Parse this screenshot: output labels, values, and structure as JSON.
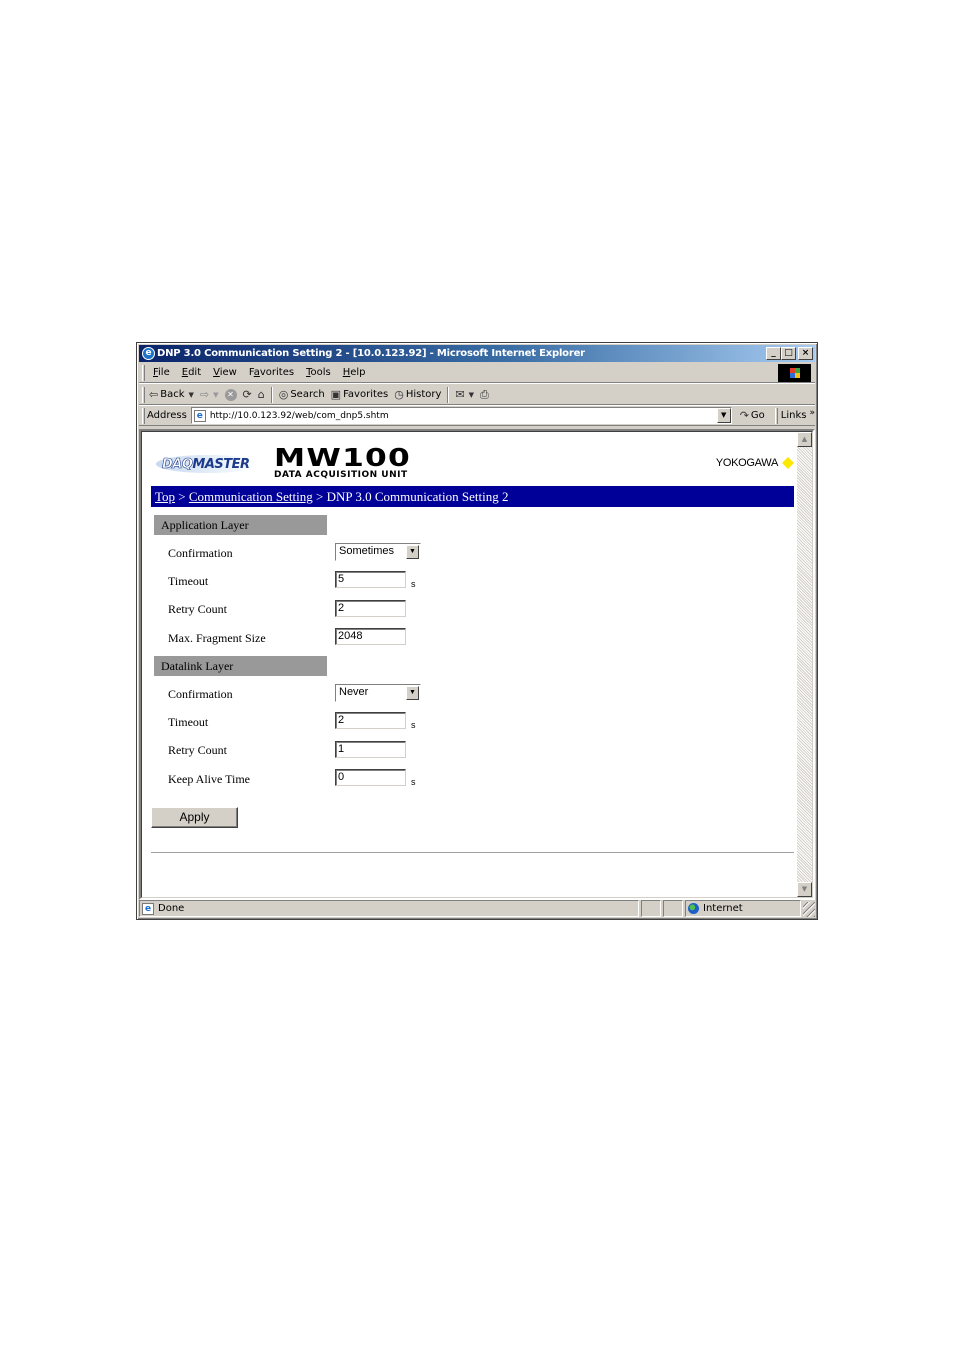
{
  "window": {
    "title": "DNP 3.0 Communication Setting 2 - [10.0.123.92] - Microsoft Internet Explorer",
    "controls": {
      "minimize": "_",
      "maximize": "□",
      "close": "×"
    }
  },
  "menubar": {
    "items": [
      {
        "label": "File",
        "accel": "F",
        "rest": "ile"
      },
      {
        "label": "Edit",
        "accel": "E",
        "rest": "dit"
      },
      {
        "label": "View",
        "accel": "V",
        "rest": "iew"
      },
      {
        "label": "Favorites",
        "pre": "F",
        "accel": "a",
        "rest": "vorites"
      },
      {
        "label": "Tools",
        "accel": "T",
        "rest": "ools"
      },
      {
        "label": "Help",
        "accel": "H",
        "rest": "elp"
      }
    ]
  },
  "toolbar": {
    "back": "Back",
    "search": "Search",
    "favorites": "Favorites",
    "history": "History",
    "icons": {
      "back": "back-arrow-icon",
      "forward": "forward-arrow-icon",
      "stop": "stop-icon",
      "refresh": "refresh-icon",
      "home": "home-icon",
      "search": "search-icon",
      "favorites": "favorites-icon",
      "history": "history-icon",
      "mail": "mail-icon",
      "print": "print-icon"
    }
  },
  "addressbar": {
    "label": "Address",
    "url": "http://10.0.123.92/web/com_dnp5.shtm",
    "go": "Go",
    "links": "Links"
  },
  "page": {
    "logo_brand": "DAQMASTER",
    "logo_brand_prefix": "DAQ",
    "logo_brand_suffix": "MASTER",
    "logo_model": "MW100",
    "logo_subtitle": "DATA ACQUISITION UNIT",
    "vendor": "YOKOGAWA",
    "breadcrumb": {
      "links": [
        "Top",
        "Communication Setting"
      ],
      "separator": " > ",
      "current": "DNP 3.0 Communication Setting 2"
    },
    "application_layer": {
      "heading": "Application Layer",
      "confirmation": {
        "label": "Confirmation",
        "value": "Sometimes"
      },
      "timeout": {
        "label": "Timeout",
        "value": "5",
        "unit": "s"
      },
      "retry_count": {
        "label": "Retry Count",
        "value": "2"
      },
      "max_fragment_size": {
        "label": "Max. Fragment Size",
        "value": "2048"
      }
    },
    "datalink_layer": {
      "heading": "Datalink Layer",
      "confirmation": {
        "label": "Confirmation",
        "value": "Never"
      },
      "timeout": {
        "label": "Timeout",
        "value": "2",
        "unit": "s"
      },
      "retry_count": {
        "label": "Retry Count",
        "value": "1"
      },
      "keep_alive_time": {
        "label": "Keep Alive Time",
        "value": "0",
        "unit": "s"
      }
    },
    "apply_label": "Apply"
  },
  "statusbar": {
    "status": "Done",
    "zone": "Internet"
  },
  "colors": {
    "breadcrumb_bg": "#000099",
    "section_bg": "#999999",
    "vendor_accent": "#ffe800"
  }
}
